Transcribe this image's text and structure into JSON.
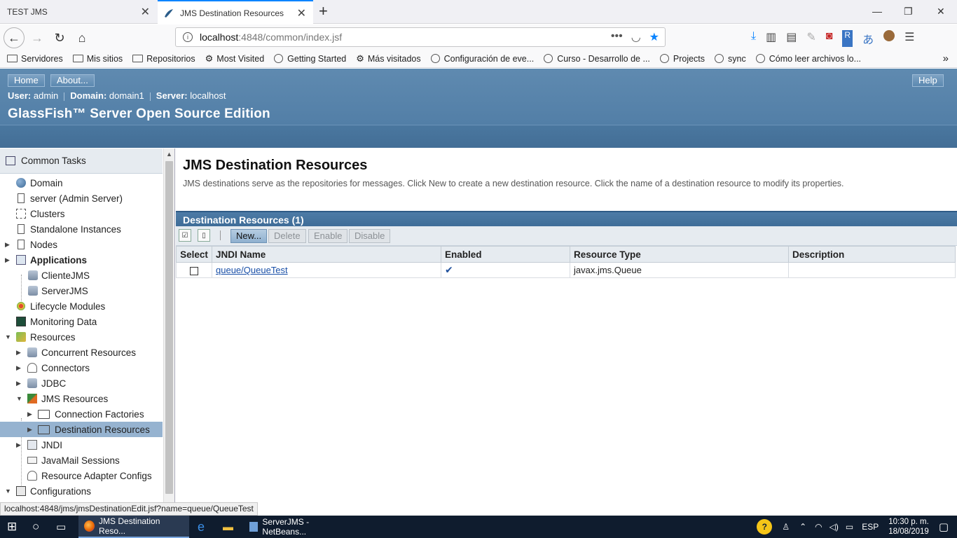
{
  "browser": {
    "tabs": [
      {
        "title": "TEST JMS",
        "active": false
      },
      {
        "title": "JMS Destination Resources",
        "active": true
      }
    ],
    "url_host": "localhost",
    "url_path": ":4848/common/index.jsf",
    "bookmarks": [
      {
        "label": "Servidores",
        "icon": "folder-icon"
      },
      {
        "label": "Mis sitios",
        "icon": "folder-icon"
      },
      {
        "label": "Repositorios",
        "icon": "folder-icon"
      },
      {
        "label": "Most Visited",
        "icon": "gear-icon"
      },
      {
        "label": "Getting Started",
        "icon": "globe-icon"
      },
      {
        "label": "Más visitados",
        "icon": "gear-icon"
      },
      {
        "label": "Configuración de eve...",
        "icon": "globe-icon"
      },
      {
        "label": "Curso - Desarrollo de ...",
        "icon": "globe-icon"
      },
      {
        "label": "Projects",
        "icon": "globe-icon"
      },
      {
        "label": "sync",
        "icon": "globe-icon"
      },
      {
        "label": "Cómo leer archivos lo...",
        "icon": "globe-icon"
      }
    ]
  },
  "header": {
    "home_label": "Home",
    "about_label": "About...",
    "help_label": "Help",
    "user_label": "User:",
    "user_value": "admin",
    "domain_label": "Domain:",
    "domain_value": "domain1",
    "server_label": "Server:",
    "server_value": "localhost",
    "brand": "GlassFish™ Server Open Source Edition"
  },
  "sidebar": {
    "common_tasks": "Common Tasks",
    "items": [
      {
        "label": "Domain",
        "name": "domain"
      },
      {
        "label": "server (Admin Server)",
        "name": "server"
      },
      {
        "label": "Clusters",
        "name": "clusters"
      },
      {
        "label": "Standalone Instances",
        "name": "standalone-instances"
      },
      {
        "label": "Nodes",
        "name": "nodes"
      },
      {
        "label": "Applications",
        "name": "applications"
      },
      {
        "label": "ClienteJMS",
        "name": "clientejms"
      },
      {
        "label": "ServerJMS",
        "name": "serverjms"
      },
      {
        "label": "Lifecycle Modules",
        "name": "lifecycle-modules"
      },
      {
        "label": "Monitoring Data",
        "name": "monitoring-data"
      },
      {
        "label": "Resources",
        "name": "resources"
      },
      {
        "label": "Concurrent Resources",
        "name": "concurrent-resources"
      },
      {
        "label": "Connectors",
        "name": "connectors"
      },
      {
        "label": "JDBC",
        "name": "jdbc"
      },
      {
        "label": "JMS Resources",
        "name": "jms-resources"
      },
      {
        "label": "Connection Factories",
        "name": "connection-factories"
      },
      {
        "label": "Destination Resources",
        "name": "destination-resources"
      },
      {
        "label": "JNDI",
        "name": "jndi"
      },
      {
        "label": "JavaMail Sessions",
        "name": "javamail-sessions"
      },
      {
        "label": "Resource Adapter Configs",
        "name": "resource-adapter-configs"
      },
      {
        "label": "Configurations",
        "name": "configurations"
      }
    ]
  },
  "main": {
    "title": "JMS Destination Resources",
    "description": "JMS destinations serve as the repositories for messages. Click New to create a new destination resource. Click the name of a destination resource to modify its properties.",
    "table_title": "Destination Resources (1)",
    "actions": {
      "new": "New...",
      "delete": "Delete",
      "enable": "Enable",
      "disable": "Disable"
    },
    "columns": [
      "Select",
      "JNDI Name",
      "Enabled",
      "Resource Type",
      "Description"
    ],
    "rows": [
      {
        "jndi_name": "queue/QueueTest",
        "enabled": "✔",
        "resource_type": "javax.jms.Queue",
        "description": ""
      }
    ]
  },
  "status_url": "localhost:4848/jms/jmsDestinationEdit.jsf?name=queue/QueueTest",
  "taskbar": {
    "apps": [
      {
        "label": "JMS Destination Reso..."
      },
      {
        "label": "ServerJMS - NetBeans..."
      }
    ],
    "language": "ESP",
    "time": "10:30 p. m.",
    "date": "18/08/2019"
  }
}
